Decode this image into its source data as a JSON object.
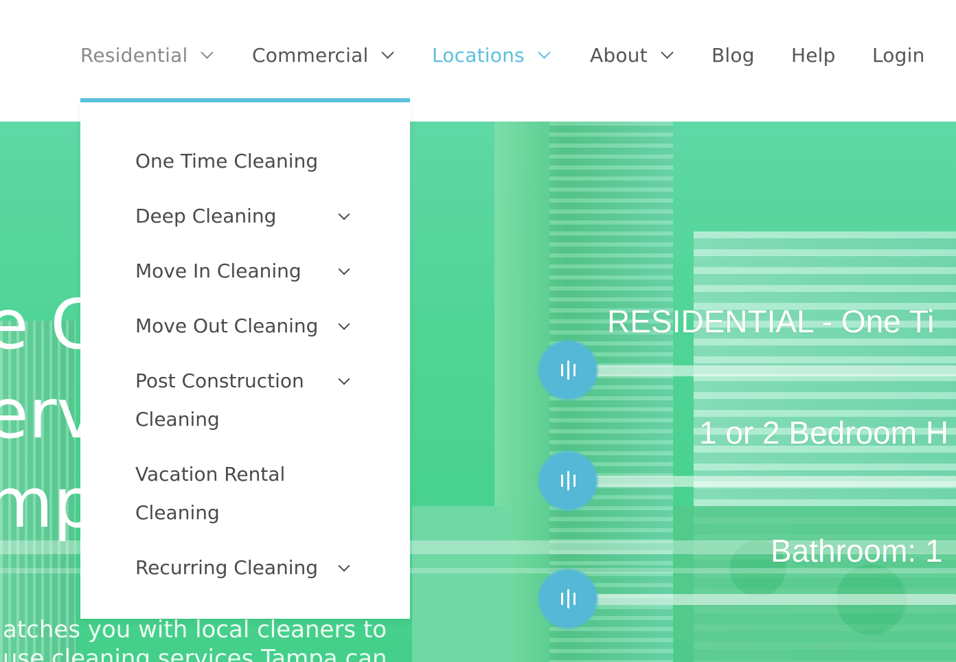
{
  "nav": {
    "items": [
      {
        "label": "Residential",
        "has_dropdown": true,
        "state": "open"
      },
      {
        "label": "Commercial",
        "has_dropdown": true
      },
      {
        "label": "Locations",
        "has_dropdown": true,
        "state": "hover"
      },
      {
        "label": "About",
        "has_dropdown": true
      },
      {
        "label": "Blog",
        "has_dropdown": false
      },
      {
        "label": "Help",
        "has_dropdown": false
      },
      {
        "label": "Login",
        "has_dropdown": false
      }
    ]
  },
  "dropdown": {
    "items": [
      {
        "label": "One Time Cleaning",
        "has_submenu": false
      },
      {
        "label": "Deep Cleaning",
        "has_submenu": true
      },
      {
        "label": "Move In Cleaning",
        "has_submenu": true
      },
      {
        "label": "Move Out Cleaning",
        "has_submenu": true
      },
      {
        "label": "Post Construction Cleaning",
        "has_submenu": true
      },
      {
        "label": "Vacation Rental Cleaning",
        "has_submenu": false
      },
      {
        "label": "Recurring Cleaning",
        "has_submenu": true
      }
    ]
  },
  "hero": {
    "heading_lines": [
      "e C",
      "erv",
      "mp"
    ],
    "subtext_lines": [
      "atches you with local cleaners to",
      "use cleaning services Tampa can"
    ]
  },
  "pricing": {
    "service_label": "RESIDENTIAL - One Ti",
    "bedroom_label": "1 or 2 Bedroom H",
    "bathroom_label": "Bathroom: 1"
  },
  "colors": {
    "accent": "#5bc0de",
    "hero_overlay": "#4fd495",
    "slider_handle": "#54b8d6"
  }
}
